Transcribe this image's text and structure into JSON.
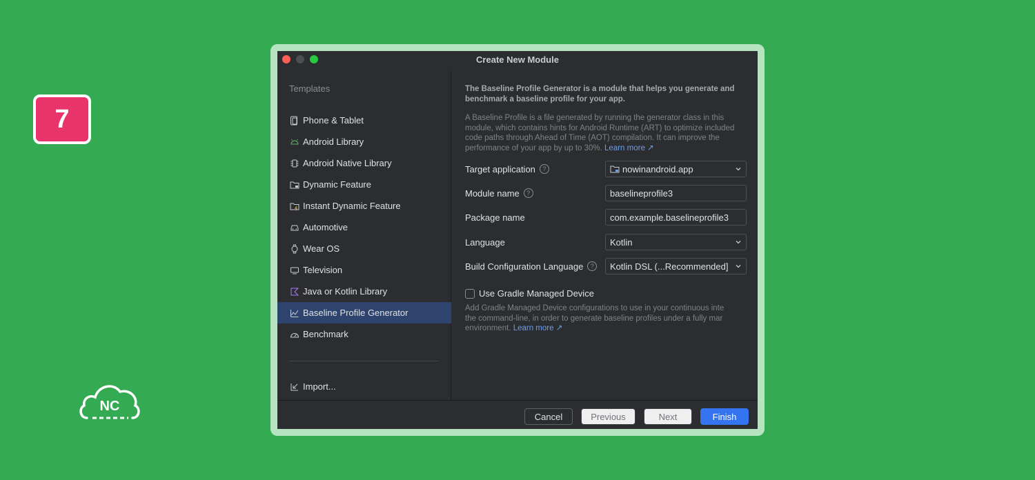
{
  "badge": {
    "number": "7"
  },
  "logo": {
    "text": "NC"
  },
  "window": {
    "title": "Create New Module",
    "sidebar": {
      "heading": "Templates",
      "items": [
        {
          "label": "Phone & Tablet",
          "icon": "phone-tablet-icon"
        },
        {
          "label": "Android Library",
          "icon": "android-icon"
        },
        {
          "label": "Android Native Library",
          "icon": "native-library-icon"
        },
        {
          "label": "Dynamic Feature",
          "icon": "dynamic-feature-icon"
        },
        {
          "label": "Instant Dynamic Feature",
          "icon": "instant-feature-icon"
        },
        {
          "label": "Automotive",
          "icon": "car-icon"
        },
        {
          "label": "Wear OS",
          "icon": "watch-icon"
        },
        {
          "label": "Television",
          "icon": "tv-icon"
        },
        {
          "label": "Java or Kotlin Library",
          "icon": "kotlin-icon"
        },
        {
          "label": "Baseline Profile Generator",
          "icon": "profile-chart-icon",
          "selected": true
        },
        {
          "label": "Benchmark",
          "icon": "gauge-icon"
        }
      ],
      "import_label": "Import..."
    },
    "description": {
      "title": "The Baseline Profile Generator is a module that helps you generate and benchmark a baseline profile for your app.",
      "body": "A Baseline Profile is a file generated by running the generator class in this module, which contains hints for Android Runtime (ART) to optimize included code paths through Ahead of Time (AOT) compilation. It can improve the performance of your app by up to 30%.",
      "link": "Learn more ↗"
    },
    "form": {
      "target_application": {
        "label": "Target application",
        "value": "nowinandroid.app"
      },
      "module_name": {
        "label": "Module name",
        "value": "baselineprofile3"
      },
      "package_name": {
        "label": "Package name",
        "value": "com.example.baselineprofile3"
      },
      "language": {
        "label": "Language",
        "value": "Kotlin"
      },
      "build_config_language": {
        "label": "Build Configuration Language",
        "value": "Kotlin DSL (...Recommended]"
      }
    },
    "gradle_managed_device": {
      "label": "Use Gradle Managed Device",
      "checked": false,
      "line1": "Add Gradle Managed Device configurations to use in your continuous inte",
      "line2": "the command-line, in order to generate baseline profiles under a fully mar",
      "line3": "environment.",
      "link": "Learn more ↗"
    },
    "footer": {
      "cancel": "Cancel",
      "previous": "Previous",
      "next": "Next",
      "finish": "Finish"
    }
  },
  "colors": {
    "background": "#34ab53",
    "badge": "#e8336b",
    "accent": "#3574f0",
    "selection": "#2e436e",
    "window": "#2b2d30"
  }
}
